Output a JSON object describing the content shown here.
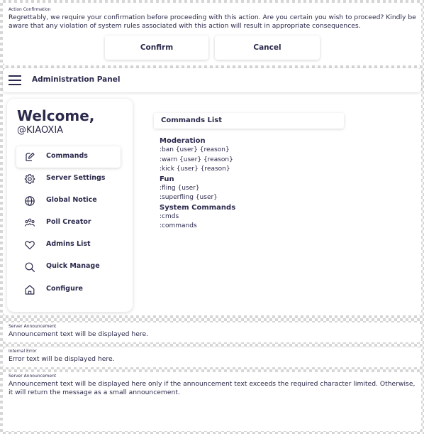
{
  "confirmation": {
    "caption": "Action Confirmation",
    "message": "Regrettably, we require your confirmation before proceeding with this action. Are you certain you wish to proceed? Kindly be aware that any violation of system rules associated with this action will result in appropriate consequences.",
    "confirm_label": "Confirm",
    "cancel_label": "Cancel"
  },
  "admin": {
    "title": "Administration Panel",
    "welcome": "Welcome,",
    "username": "@KIAOXIA",
    "nav": [
      {
        "label": "Commands",
        "icon": "edit-icon",
        "active": true
      },
      {
        "label": "Server Settings",
        "icon": "gear-icon",
        "active": false
      },
      {
        "label": "Global Notice",
        "icon": "globe-icon",
        "active": false
      },
      {
        "label": "Poll Creator",
        "icon": "users-icon",
        "active": false
      },
      {
        "label": "Admins List",
        "icon": "heart-icon",
        "active": false
      },
      {
        "label": "Quick Manage",
        "icon": "search-icon",
        "active": false
      },
      {
        "label": "Configure",
        "icon": "home-icon",
        "active": false
      }
    ],
    "commands_header": "Commands List",
    "categories": [
      {
        "name": "Moderation",
        "commands": [
          ":ban {user} {reason}",
          ":warn {user} {reason}",
          ":kick {user} {reason}"
        ]
      },
      {
        "name": "Fun",
        "commands": [
          ":fling {user}",
          ":superfling {user}"
        ]
      },
      {
        "name": "System Commands",
        "commands": [
          ":cmds",
          ":commands"
        ]
      }
    ]
  },
  "announcement": {
    "caption": "Server Announcement",
    "text": "Announcement text will be displayed here."
  },
  "error": {
    "caption": "Internal Error",
    "text": "Error text will be displayed here."
  },
  "long_announcement": {
    "caption": "Server Announcement",
    "text": "Announcement text will be displayed here only if the announcement text exceeds the required character limited. Otherwise, it will return the message as a small announcement."
  },
  "colors": {
    "text": "#2b2a4c",
    "panel": "#ffffff",
    "checker": "#d6d6d6"
  }
}
